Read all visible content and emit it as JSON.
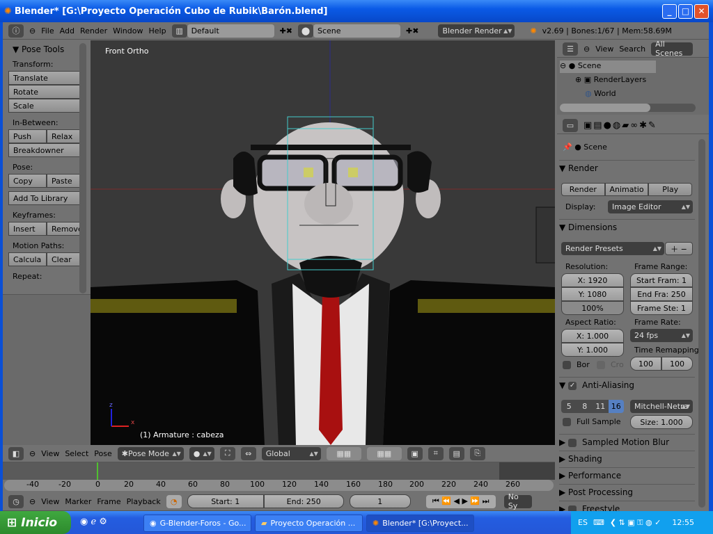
{
  "window": {
    "title": "Blender* [G:\\Proyecto Operación Cubo de Rubik\\Barón.blend]",
    "min": "_",
    "max": "□",
    "close": "✕"
  },
  "info_header": {
    "menus": [
      "File",
      "Add",
      "Render",
      "Window",
      "Help"
    ],
    "screen_layout": "Default",
    "scene": "Scene",
    "engine": "Blender Render",
    "stats": "v2.69 | Bones:1/67 | Mem:58.69M"
  },
  "tool_panel": {
    "title": "Pose Tools",
    "sections": {
      "transform": {
        "label": "Transform:",
        "buttons": [
          "Translate",
          "Rotate",
          "Scale"
        ]
      },
      "inbetween": {
        "label": "In-Between:",
        "push": "Push",
        "relax": "Relax",
        "breakdowner": "Breakdowner"
      },
      "pose": {
        "label": "Pose:",
        "copy": "Copy",
        "paste": "Paste",
        "add_library": "Add To Library"
      },
      "keyframes": {
        "label": "Keyframes:",
        "insert": "Insert",
        "remove": "Remove"
      },
      "motion_paths": {
        "label": "Motion Paths:",
        "calculate": "Calcula",
        "clear": "Clear"
      },
      "repeat": {
        "label": "Repeat:"
      }
    }
  },
  "viewport": {
    "view_name": "Front Ortho",
    "object_info": "(1) Armature : cabeza",
    "axis_x": "x",
    "axis_z": "z"
  },
  "view3d_header": {
    "menus": [
      "View",
      "Select",
      "Pose"
    ],
    "mode": "Pose Mode",
    "orientation": "Global"
  },
  "timeline": {
    "ticks": [
      "-40",
      "-20",
      "0",
      "20",
      "40",
      "60",
      "80",
      "100",
      "120",
      "140",
      "160",
      "180",
      "200",
      "220",
      "240",
      "260"
    ],
    "current_frame": 0
  },
  "timeline_header": {
    "menus": [
      "View",
      "Marker",
      "Frame",
      "Playback"
    ],
    "start": "Start: 1",
    "end": "End: 250",
    "frame": "1",
    "sync": "No Sy"
  },
  "outliner": {
    "view": "View",
    "search": "Search",
    "filter": "All Scenes",
    "items": [
      "Scene",
      "RenderLayers",
      "World"
    ]
  },
  "properties": {
    "context": "Scene",
    "render": {
      "title": "Render",
      "render_btn": "Render",
      "animation_btn": "Animatio",
      "play_btn": "Play",
      "display_label": "Display:",
      "display_value": "Image Editor"
    },
    "dimensions": {
      "title": "Dimensions",
      "presets": "Render Presets",
      "resolution_label": "Resolution:",
      "res_x": "X: 1920",
      "res_y": "Y: 1080",
      "res_pct": "100%",
      "frame_range_label": "Frame Range:",
      "start": "Start Fram: 1",
      "end": "End Fra: 250",
      "step": "Frame Ste: 1",
      "aspect_label": "Aspect Ratio:",
      "asp_x": "X: 1.000",
      "asp_y": "Y: 1.000",
      "border": "Bor",
      "crop": "Cro",
      "frame_rate_label": "Frame Rate:",
      "fps": "24 fps",
      "remap_label": "Time Remapping",
      "remap_old": "100",
      "remap_new": "100"
    },
    "aa": {
      "title": "Anti-Aliasing",
      "samples": [
        "5",
        "8",
        "11",
        "16"
      ],
      "selected_sample": "16",
      "filter": "Mitchell-Netra",
      "full_sample": "Full Sample",
      "size": "Size: 1.000"
    },
    "collapsed": [
      "Sampled Motion Blur",
      "Shading",
      "Performance",
      "Post Processing",
      "Freestyle"
    ]
  },
  "taskbar": {
    "start": "Inicio",
    "tasks": [
      "G-Blender-Foros - Go...",
      "Proyecto Operación ...",
      "Blender* [G:\\Proyect..."
    ],
    "lang": "ES",
    "clock": "12:55"
  },
  "colors": {
    "accent": "#5680c2",
    "timeline_marker": "#50c030"
  }
}
